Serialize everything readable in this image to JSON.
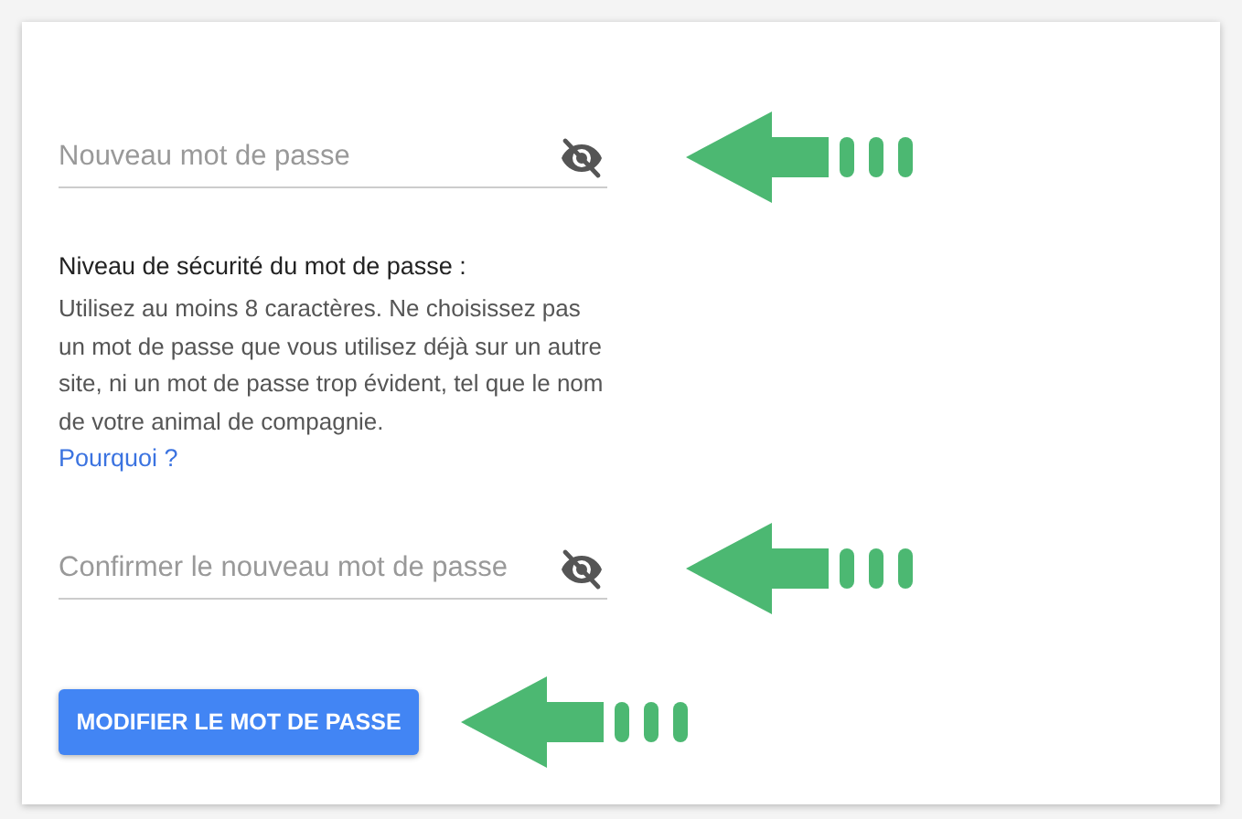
{
  "new_password": {
    "placeholder": "Nouveau mot de passe",
    "password_visible": false
  },
  "strength": {
    "title": "Niveau de sécurité du mot de passe :",
    "help": "Utilisez au moins 8 caractères. Ne choisissez pas un mot de passe que vous utilisez déjà sur un autre site, ni un mot de passe trop évident, tel que le nom de votre animal de compagnie.",
    "link": "Pourquoi ?"
  },
  "confirm_password": {
    "placeholder": "Confirmer le nouveau mot de passe",
    "password_visible": false
  },
  "submit_button": {
    "label": "MODIFIER LE MOT DE PASSE"
  }
}
